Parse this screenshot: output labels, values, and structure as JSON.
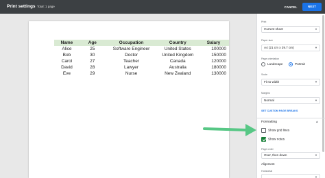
{
  "header": {
    "title": "Print settings",
    "subtitle": "Total: 1 page",
    "cancel_label": "CANCEL",
    "next_label": "NEXT"
  },
  "sheet": {
    "headers": [
      "Name",
      "Age",
      "Occupation",
      "Country",
      "Salary"
    ],
    "rows": [
      [
        "Alice",
        "25",
        "Software Engineer",
        "United States",
        "100000"
      ],
      [
        "Bob",
        "30",
        "Doctor",
        "United Kingdom",
        "150000"
      ],
      [
        "Carol",
        "27",
        "Teacher",
        "Canada",
        "120000"
      ],
      [
        "David",
        "28",
        "Lawyer",
        "Australia",
        "180000"
      ],
      [
        "Eve",
        "29",
        "Nurse",
        "New Zealand",
        "130000"
      ]
    ],
    "header_color": "#d9ead3"
  },
  "panel": {
    "print_label": "Print",
    "print_value": "Current sheet",
    "paper_size_label": "Paper size",
    "paper_size_value": "A4 (21 cm x 29.7 cm)",
    "orientation_label": "Page orientation",
    "orientation_options": [
      "Landscape",
      "Portrait"
    ],
    "orientation_selected": "Portrait",
    "scale_label": "Scale",
    "scale_value": "Fit to width",
    "margins_label": "Margins",
    "margins_value": "Normal",
    "custom_breaks_link": "SET CUSTOM PAGE BREAKS",
    "formatting_label": "Formatting",
    "show_grid_lines": {
      "label": "Show grid lines",
      "checked": false
    },
    "show_notes": {
      "label": "Show notes",
      "checked": true
    },
    "page_order_label": "Page order",
    "page_order_value": "Over, then down",
    "alignment_label": "Alignment",
    "horizontal_label": "Horizontal"
  },
  "colors": {
    "accent": "#1a73e8",
    "checkbox_on": "#188038",
    "arrow": "#57c785"
  }
}
